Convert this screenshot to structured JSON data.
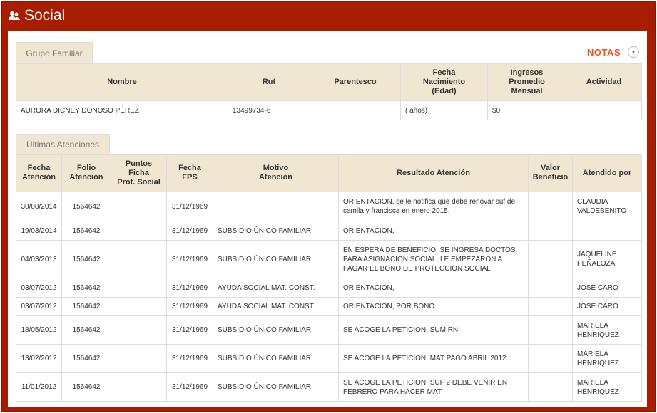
{
  "title": "Social",
  "icon": "users-icon",
  "notas": "NOTAS",
  "grupo": {
    "tab": "Grupo Familiar",
    "headers": [
      "Nombre",
      "Rut",
      "Parentesco",
      "Fecha\nNacimiento\n(Edad)",
      "Ingresos\nPromedio\nMensual",
      "Actividad"
    ],
    "rows": [
      [
        "AURORA DICNEY DONOSO PÉREZ",
        "13499734-6",
        "",
        "( años)",
        "$0",
        ""
      ]
    ]
  },
  "atenciones": {
    "tab": "Últimas Atenciones",
    "headers": [
      "Fecha\nAtención",
      "Folio\nAtención",
      "Puntos\nFicha\nProt. Social",
      "Fecha\nFPS",
      "Motivo\nAtención",
      "Resultado Atención",
      "Valor\nBeneficio",
      "Atendido por"
    ],
    "rows": [
      [
        "30/08/2014",
        "1564642",
        "",
        "31/12/1969",
        "",
        "ORIENTACION, se le notifica que debe renovar suf de camila y francisca en enero 2015.",
        "",
        "CLAUDIA VALDEBENITO"
      ],
      [
        "19/03/2014",
        "1564642",
        "",
        "31/12/1969",
        "SUBSIDIO ÚNICO FAMILIAR",
        "ORIENTACION,",
        "",
        ""
      ],
      [
        "04/03/2013",
        "1564642",
        "",
        "31/12/1969",
        "SUBSIDIO ÚNICO FAMILIAR",
        "EN ESPERA DE BENEFICIO, SE INGRESA DOCTOS. PARA ASIGNACION SOCIAL, LE EMPEZARON A PAGAR EL BONO DE PROTECCION SOCIAL",
        "",
        "JAQUELINE PEÑALOZA"
      ],
      [
        "03/07/2012",
        "1564642",
        "",
        "31/12/1969",
        "AYUDA SOCIAL MAT. CONST.",
        "ORIENTACION,",
        "",
        "JOSE CARO"
      ],
      [
        "03/07/2012",
        "1564642",
        "",
        "31/12/1969",
        "AYUDA SOCIAL MAT. CONST.",
        "ORIENTACION, POR BONO",
        "",
        "JOSE CARO"
      ],
      [
        "18/05/2012",
        "1564642",
        "",
        "31/12/1969",
        "SUBSIDIO ÚNICO FAMILIAR",
        "SE ACOGE LA PETICION, SUM RN",
        "",
        "MARIELA HENRIQUEZ"
      ],
      [
        "13/02/2012",
        "1564642",
        "",
        "31/12/1969",
        "SUBSIDIO ÚNICO FAMILIAR",
        "SE ACOGE LA PETICION, MAT PAGO ABRIL 2012",
        "",
        "MARIELA HENRIQUEZ"
      ],
      [
        "11/01/2012",
        "1564642",
        "",
        "31/12/1969",
        "SUBSIDIO ÚNICO FAMILIAR",
        "SE ACOGE LA PETICION, SUF 2 DEBE VENIR EN FEBRERO PARA HACER MAT",
        "",
        "MARIELA HENRIQUEZ"
      ]
    ]
  }
}
